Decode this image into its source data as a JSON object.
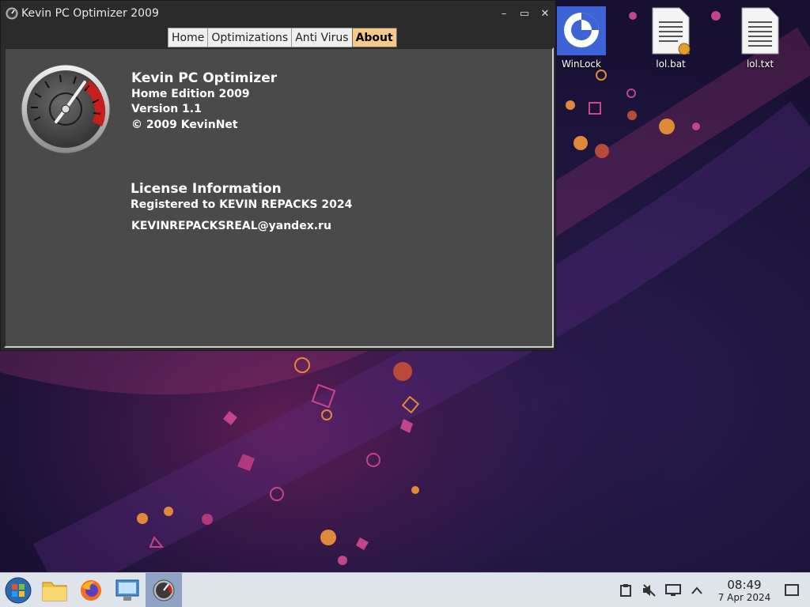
{
  "window": {
    "title": "Kevin PC Optimizer 2009",
    "minimize_label": "–",
    "maximize_label": "▭",
    "close_label": "✕",
    "tabs": [
      {
        "label": "Home",
        "active": false
      },
      {
        "label": "Optimizations",
        "active": false
      },
      {
        "label": "Anti Virus",
        "active": false
      },
      {
        "label": "About",
        "active": true
      }
    ]
  },
  "about": {
    "product_name": "Kevin PC Optimizer",
    "edition": "Home Edition 2009",
    "version": "Version 1.1",
    "copyright": "© 2009 KevinNet",
    "license_heading": "License Information",
    "registered_to": "Registered to KEVIN REPACKS 2024",
    "email": "KEVINREPACKSREAL@yandex.ru"
  },
  "desktop": {
    "icons": [
      {
        "label": "WinLock",
        "icon": "winlock-icon"
      },
      {
        "label": "lol.bat",
        "icon": "batch-file-icon"
      },
      {
        "label": "lol.txt",
        "icon": "text-file-icon"
      }
    ]
  },
  "taskbar": {
    "items": [
      "start-menu-icon",
      "file-manager-icon",
      "firefox-icon",
      "control-panel-icon",
      "kevin-optimizer-icon"
    ],
    "clock_time": "08:49",
    "clock_date": "7 Apr 2024"
  },
  "colors": {
    "active_tab": "#f4c98a",
    "panel_bg": "#4a4a4a",
    "window_bg": "#2b2b2b",
    "gauge_red": "#c81e1e"
  }
}
